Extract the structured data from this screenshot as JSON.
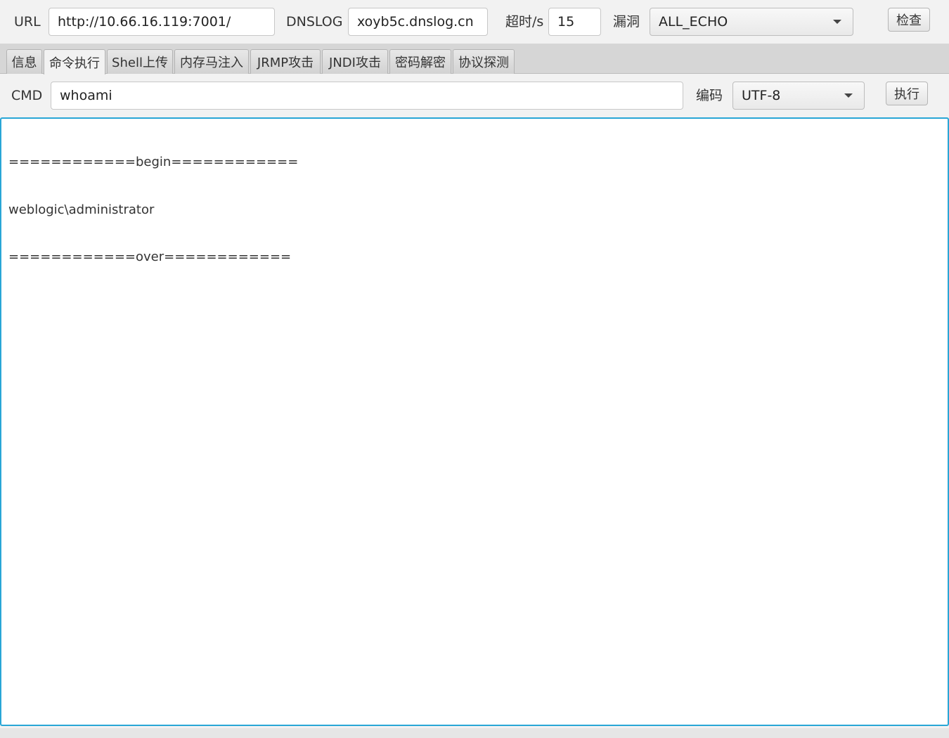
{
  "top": {
    "url_label": "URL",
    "url_value": "http://10.66.16.119:7001/",
    "dnslog_label": "DNSLOG",
    "dnslog_value": "xoyb5c.dnslog.cn",
    "timeout_label": "超时/s",
    "timeout_value": "15",
    "vuln_label": "漏洞",
    "vuln_selected": "ALL_ECHO",
    "check_button": "检查"
  },
  "tabs": [
    {
      "label": "信息"
    },
    {
      "label": "命令执行"
    },
    {
      "label": "Shell上传"
    },
    {
      "label": "内存马注入"
    },
    {
      "label": "JRMP攻击"
    },
    {
      "label": "JNDI攻击"
    },
    {
      "label": "密码解密"
    },
    {
      "label": "协议探测"
    }
  ],
  "active_tab": "命令执行",
  "cmd": {
    "label": "CMD",
    "value": "whoami",
    "encoding_label": "编码",
    "encoding_selected": "UTF-8",
    "execute_button": "执行"
  },
  "output": {
    "lines": [
      "============begin============",
      "weblogic\\administrator",
      "============over============"
    ]
  },
  "colors": {
    "focus_border": "#29a6d6"
  }
}
